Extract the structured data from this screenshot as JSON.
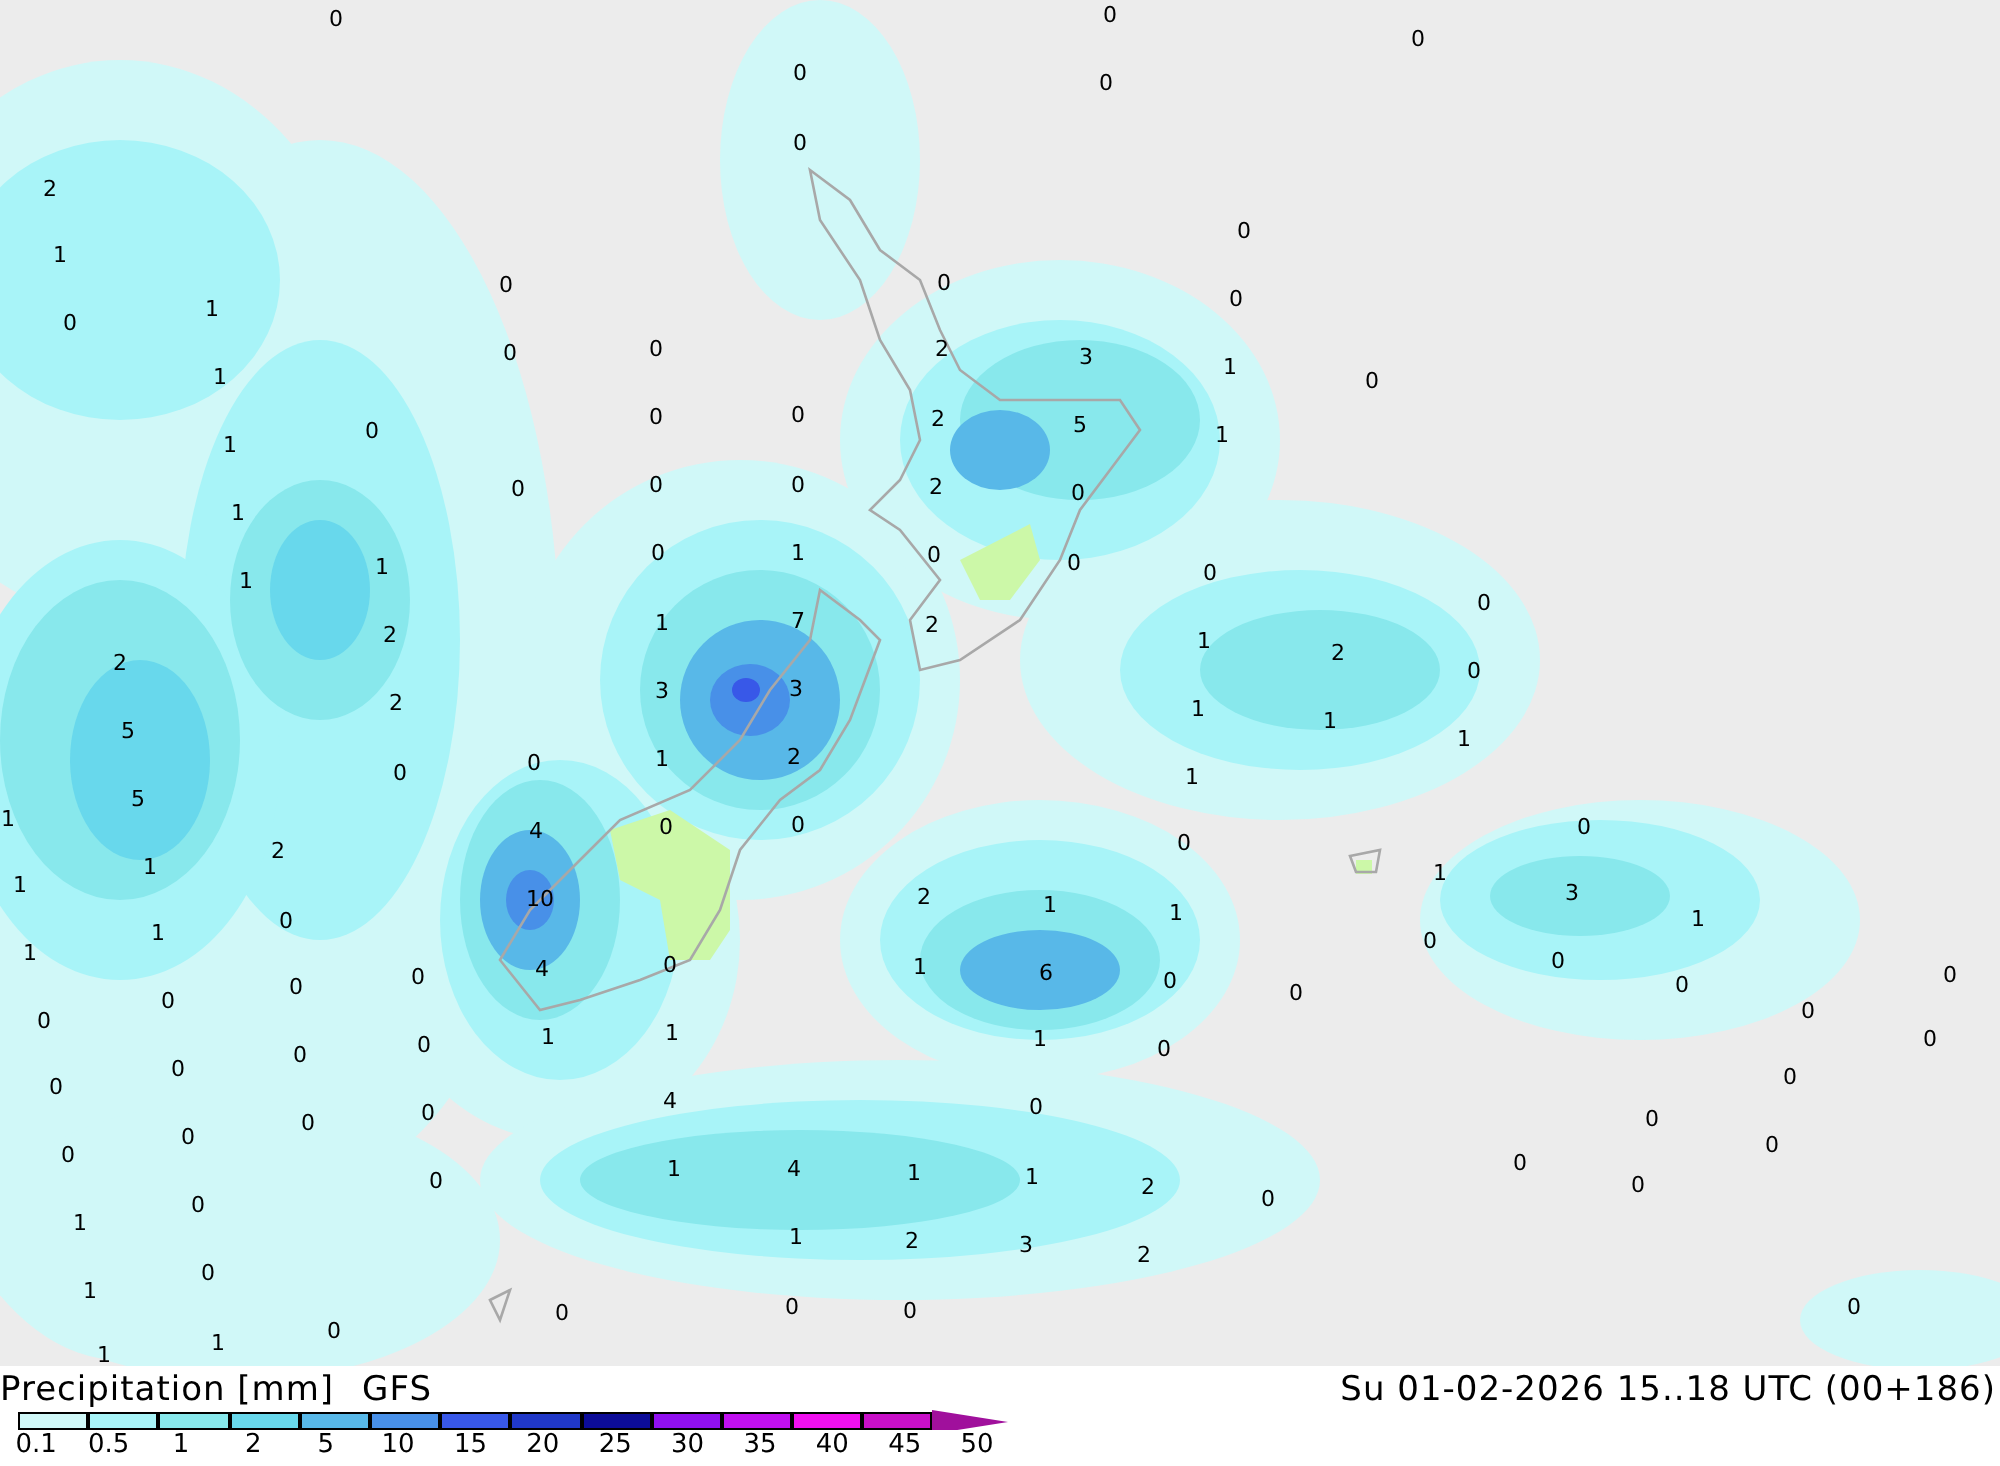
{
  "map": {
    "labels": [
      "0",
      "0",
      "0",
      "0",
      "0",
      "0",
      "2",
      "0",
      "1",
      "0",
      "0",
      "1",
      "0",
      "0",
      "0",
      "0",
      "2",
      "3",
      "1",
      "1",
      "0",
      "0",
      "0",
      "0",
      "2",
      "5",
      "1",
      "1",
      "0",
      "0",
      "0",
      "2",
      "0",
      "1",
      "0",
      "1",
      "0",
      "0",
      "1",
      "1",
      "0",
      "0",
      "1",
      "7",
      "2",
      "2",
      "1",
      "2",
      "2",
      "0",
      "3",
      "3",
      "2",
      "1",
      "1",
      "5",
      "1",
      "0",
      "1",
      "2",
      "0",
      "1",
      "5",
      "1",
      "4",
      "0",
      "0",
      "0",
      "2",
      "0",
      "1",
      "1",
      "1",
      "10",
      "2",
      "1",
      "3",
      "0",
      "1",
      "1",
      "1",
      "0",
      "1",
      "0",
      "4",
      "0",
      "1",
      "6",
      "0",
      "0",
      "0",
      "0",
      "0",
      "0",
      "0",
      "0",
      "0",
      "0",
      "1",
      "1",
      "1",
      "0",
      "0",
      "0",
      "0",
      "0",
      "0",
      "0",
      "4",
      "0",
      "0",
      "0",
      "0",
      "0",
      "0",
      "0",
      "0",
      "1",
      "4",
      "1",
      "1",
      "2",
      "0",
      "0",
      "0",
      "1",
      "1",
      "2",
      "3",
      "2",
      "0",
      "1",
      "0",
      "0",
      "0",
      "0",
      "0",
      "1",
      "1"
    ]
  },
  "header": {
    "title": "Precipitation [mm]",
    "model": "GFS",
    "valid_time": "Su 01-02-2026 15..18 UTC (00+186)"
  },
  "legend": {
    "swatches": [
      {
        "kind": "box",
        "color": "#d0f8f8"
      },
      {
        "kind": "box",
        "color": "#a8f4f8"
      },
      {
        "kind": "box",
        "color": "#88e8ec"
      },
      {
        "kind": "box",
        "color": "#68d8ec"
      },
      {
        "kind": "box",
        "color": "#58b8e8"
      },
      {
        "kind": "box",
        "color": "#4890e8"
      },
      {
        "kind": "box",
        "color": "#3858e8"
      },
      {
        "kind": "box",
        "color": "#2038c8"
      },
      {
        "kind": "box",
        "color": "#0c0c98"
      },
      {
        "kind": "box",
        "color": "#9010f0"
      },
      {
        "kind": "box",
        "color": "#c010f0"
      },
      {
        "kind": "box",
        "color": "#f010f0"
      },
      {
        "kind": "box",
        "color": "#c810c8"
      },
      {
        "kind": "arrow",
        "color": "#a0109c"
      }
    ],
    "ticks": [
      "0.1",
      "0.5",
      "1",
      "2",
      "5",
      "10",
      "15",
      "20",
      "25",
      "30",
      "35",
      "40",
      "45",
      "50"
    ]
  }
}
